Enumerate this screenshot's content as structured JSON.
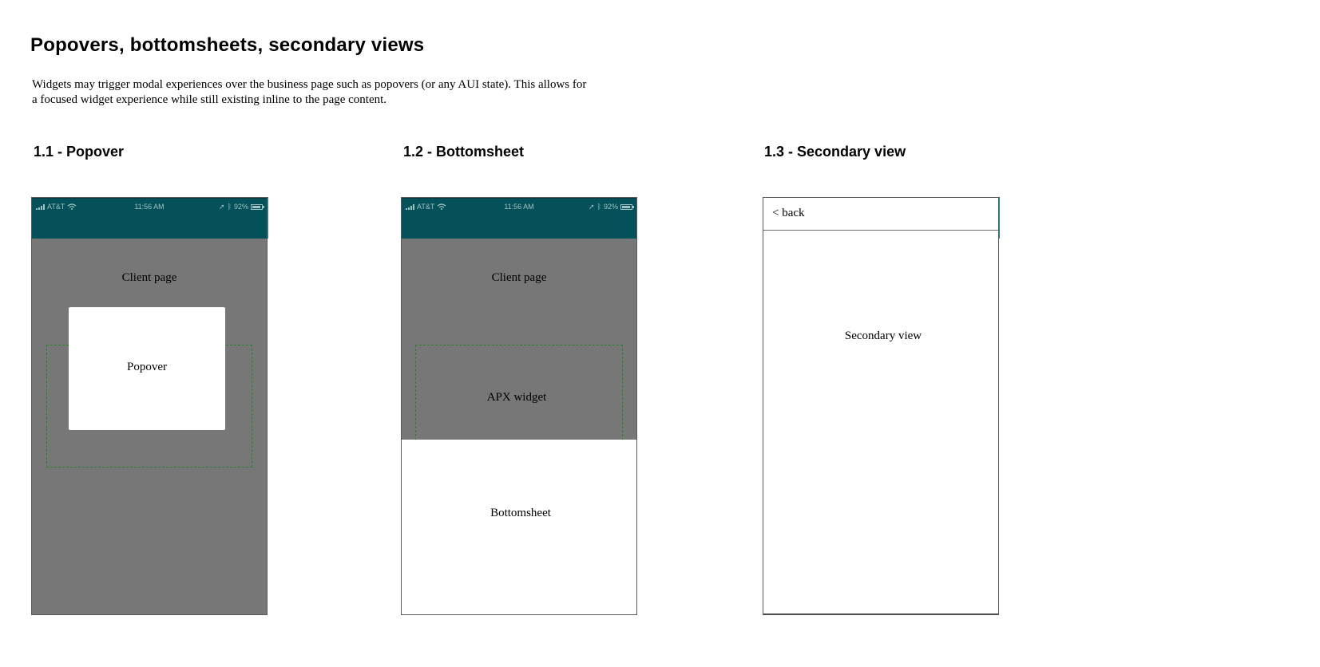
{
  "page": {
    "title": "Popovers, bottomsheets, secondary views",
    "intro": "Widgets may trigger modal experiences over the business page such as popovers (or any AUI state).  This allows for a focused widget experience while still existing inline to the page content."
  },
  "status_bar": {
    "carrier": "AT&T",
    "time": "11:56 AM",
    "battery": "92%",
    "icons": [
      "signal-icon",
      "wifi-icon",
      "location-arrow-icon",
      "bluetooth-icon",
      "battery-icon"
    ]
  },
  "colors": {
    "status_bar": "#045159",
    "client_page_overlay": "#777777",
    "widget_outline": "#2e7d32"
  },
  "sections": [
    {
      "heading": "1.1 - Popover",
      "client_page_label": "Client page",
      "popover_label": "Popover"
    },
    {
      "heading": "1.2 - Bottomsheet",
      "client_page_label": "Client page",
      "widget_label": "APX widget",
      "bottomsheet_label": "Bottomsheet"
    },
    {
      "heading": "1.3 - Secondary view",
      "back_label": "< back",
      "view_label": "Secondary view"
    }
  ]
}
